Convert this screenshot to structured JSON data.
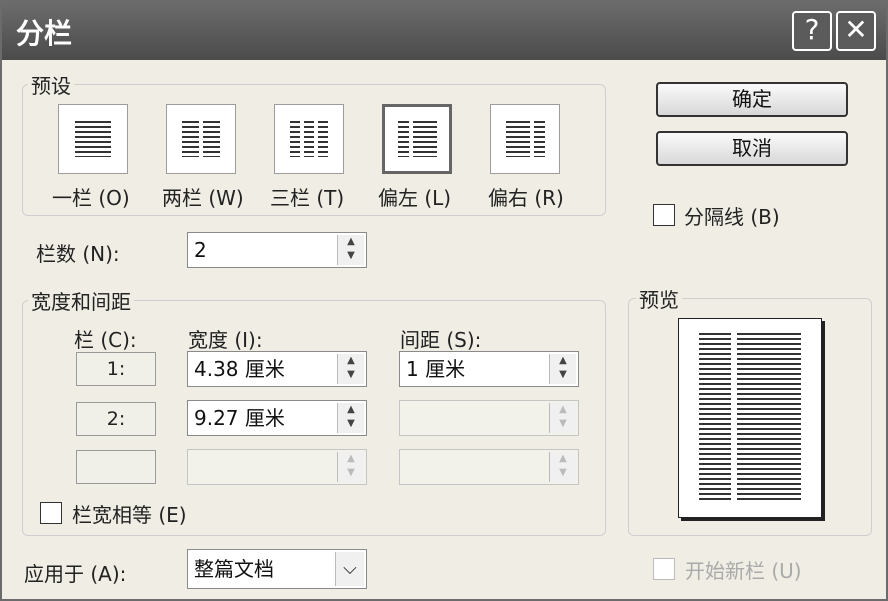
{
  "title": "分栏",
  "titlebar": {
    "help": "?",
    "close": "✕"
  },
  "presets": {
    "legend": "预设",
    "items": [
      {
        "label": "一栏 (O)"
      },
      {
        "label": "两栏 (W)"
      },
      {
        "label": "三栏 (T)"
      },
      {
        "label": "偏左 (L)"
      },
      {
        "label": "偏右 (R)"
      }
    ]
  },
  "buttons": {
    "ok": "确定",
    "cancel": "取消"
  },
  "separator": {
    "label": "分隔线 (B)",
    "checked": false
  },
  "numcols": {
    "label": "栏数 (N):",
    "value": "2"
  },
  "widthspacing": {
    "legend": "宽度和间距",
    "col_header": "栏 (C):",
    "width_header": "宽度 (I):",
    "spacing_header": "间距 (S):",
    "rows": [
      {
        "num": "1:",
        "width": "4.38 厘米",
        "spacing": "1 厘米"
      },
      {
        "num": "2:",
        "width": "9.27 厘米",
        "spacing": ""
      },
      {
        "num": "",
        "width": "",
        "spacing": ""
      }
    ],
    "equal": {
      "label": "栏宽相等 (E)",
      "checked": false
    }
  },
  "preview": {
    "legend": "预览"
  },
  "applyto": {
    "label": "应用于 (A):",
    "value": "整篇文档"
  },
  "newcol": {
    "label": "开始新栏 (U)",
    "checked": false,
    "disabled": true
  }
}
